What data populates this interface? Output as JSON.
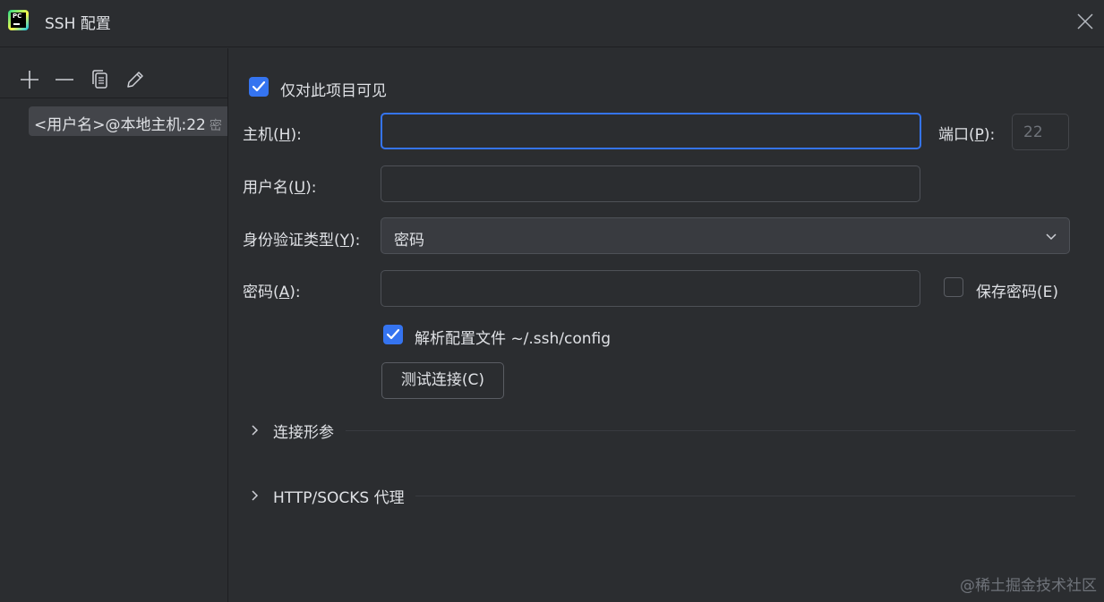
{
  "window": {
    "title": "SSH 配置",
    "app_icon_text": "PC",
    "close_icon": "close-icon"
  },
  "sidebar": {
    "toolbar": [
      {
        "name": "add-icon"
      },
      {
        "name": "remove-icon"
      },
      {
        "name": "copy-icon"
      },
      {
        "name": "edit-icon"
      }
    ],
    "items": [
      {
        "label": "<用户名>@本地主机:22",
        "sub": "密"
      }
    ]
  },
  "form": {
    "visible_only_this_project": {
      "label": "仅对此项目可见",
      "checked": true
    },
    "host": {
      "label_prefix": "主机(",
      "mnemonic": "H",
      "label_suffix": "):",
      "value": ""
    },
    "port": {
      "label_prefix": "端口(",
      "mnemonic": "P",
      "label_suffix": "):",
      "value": "22"
    },
    "username": {
      "label_prefix": "用户名(",
      "mnemonic": "U",
      "label_suffix": "):",
      "value": ""
    },
    "auth_type": {
      "label_prefix": "身份验证类型(",
      "mnemonic": "Y",
      "label_suffix": "):",
      "value": "密码"
    },
    "password": {
      "label_prefix": "密码(",
      "mnemonic": "A",
      "label_suffix": "):",
      "value": ""
    },
    "save_password": {
      "label": "保存密码(E)",
      "checked": false
    },
    "parse_config": {
      "label": "解析配置文件 ~/.ssh/config",
      "checked": true
    },
    "test_connection": {
      "label": "测试连接(C)"
    },
    "sections": [
      {
        "title": "连接形参"
      },
      {
        "title": "HTTP/SOCKS 代理"
      }
    ]
  },
  "watermark": "@稀土掘金技术社区",
  "colors": {
    "background": "#2b2d30",
    "accent": "#3574f0",
    "text": "#dfe1e5",
    "selected_item": "#43454a"
  }
}
